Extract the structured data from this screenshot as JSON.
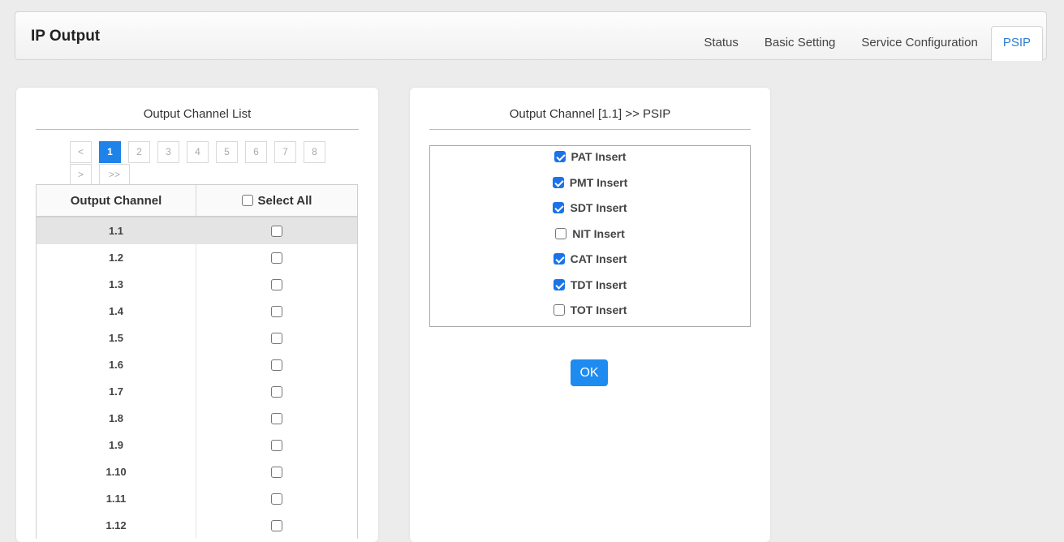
{
  "header": {
    "title": "IP Output",
    "tabs": [
      {
        "label": "Status"
      },
      {
        "label": "Basic Setting"
      },
      {
        "label": "Service Configuration"
      },
      {
        "label": "PSIP",
        "active": true
      }
    ]
  },
  "left_panel": {
    "title": "Output Channel List",
    "pager": {
      "prev": "<",
      "pages": [
        "1",
        "2",
        "3",
        "4",
        "5",
        "6",
        "7",
        "8"
      ],
      "current_page": "1",
      "next": ">",
      "last": ">>"
    },
    "table": {
      "col_channel": "Output Channel",
      "col_select_all": "Select All",
      "select_all_checked": false,
      "rows": [
        {
          "channel": "1.1",
          "checked": false,
          "selected": true
        },
        {
          "channel": "1.2",
          "checked": false
        },
        {
          "channel": "1.3",
          "checked": false
        },
        {
          "channel": "1.4",
          "checked": false
        },
        {
          "channel": "1.5",
          "checked": false
        },
        {
          "channel": "1.6",
          "checked": false
        },
        {
          "channel": "1.7",
          "checked": false
        },
        {
          "channel": "1.8",
          "checked": false
        },
        {
          "channel": "1.9",
          "checked": false
        },
        {
          "channel": "1.10",
          "checked": false
        },
        {
          "channel": "1.11",
          "checked": false
        },
        {
          "channel": "1.12",
          "checked": false
        }
      ]
    }
  },
  "right_panel": {
    "title": "Output Channel  [1.1] >> PSIP",
    "options": [
      {
        "label": "PAT Insert",
        "checked": true
      },
      {
        "label": "PMT Insert",
        "checked": true
      },
      {
        "label": "SDT Insert",
        "checked": true
      },
      {
        "label": "NIT Insert",
        "checked": false
      },
      {
        "label": "CAT Insert",
        "checked": true
      },
      {
        "label": "TDT Insert",
        "checked": true
      },
      {
        "label": "TOT Insert",
        "checked": false
      }
    ],
    "ok_label": "OK"
  },
  "colors": {
    "accent": "#1e82e8",
    "active_tab_text": "#2e7bd6",
    "background": "#ececec"
  }
}
